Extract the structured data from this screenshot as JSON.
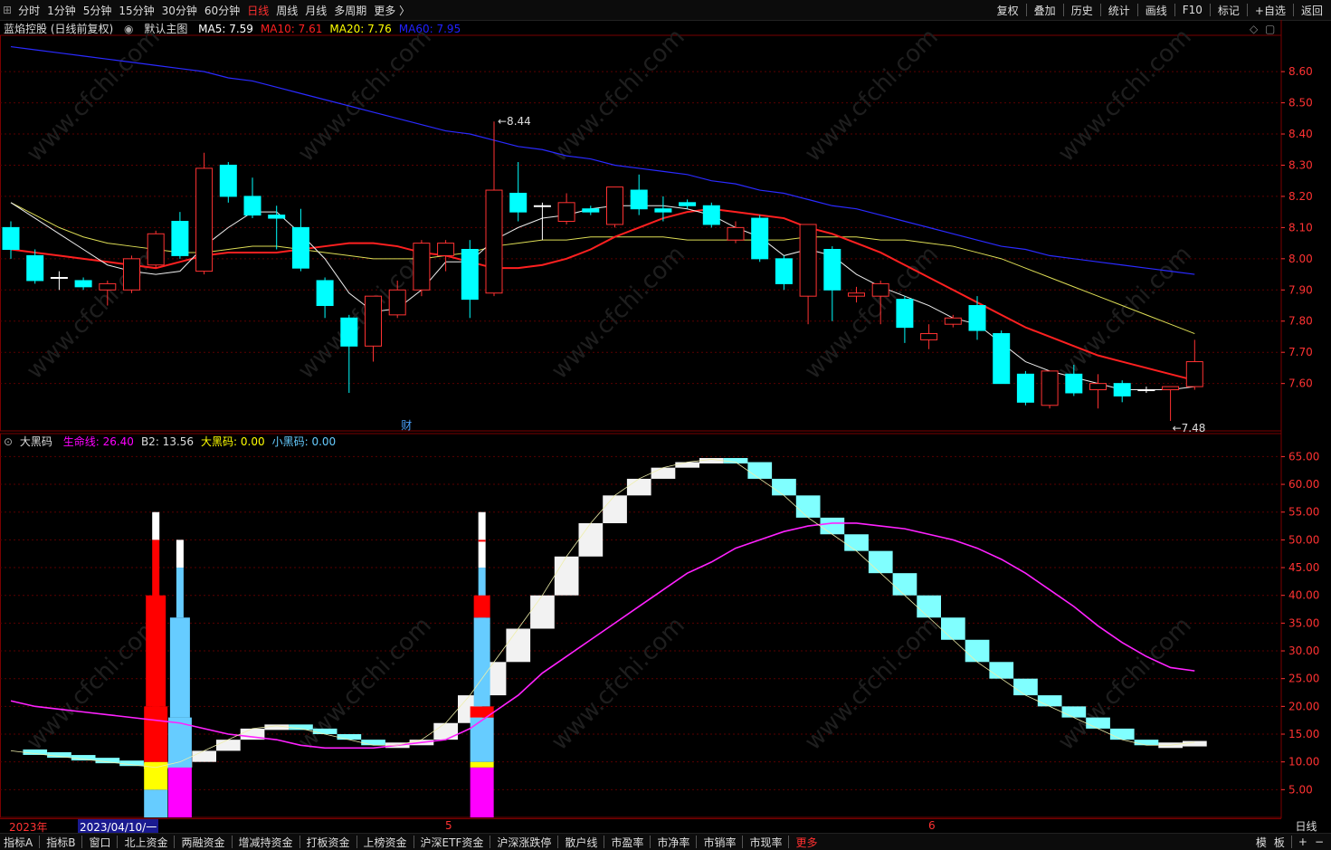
{
  "toolbar": {
    "periods": [
      "分时",
      "1分钟",
      "5分钟",
      "15分钟",
      "30分钟",
      "60分钟",
      "日线",
      "周线",
      "月线",
      "多周期",
      "更多 〉"
    ],
    "active_period": "日线",
    "actions": [
      "复权",
      "叠加",
      "历史",
      "统计",
      "画线",
      "F10",
      "标记",
      "+自选",
      "返回"
    ]
  },
  "main_chart": {
    "stock_name": "蓝焰控股 (日线前复权)",
    "indicator": "默认主图",
    "ma": [
      {
        "label": "MA5: 7.59",
        "color": "#ffffff"
      },
      {
        "label": "MA10: 7.61",
        "color": "#ff2020"
      },
      {
        "label": "MA20: 7.76",
        "color": "#ffff00"
      },
      {
        "label": "MA60: 7.95",
        "color": "#2020ff"
      }
    ],
    "high_label": "8.44",
    "low_label": "7.48",
    "event_marker": "财",
    "y_ticks": [
      "8.60",
      "8.50",
      "8.40",
      "8.30",
      "8.20",
      "8.10",
      "8.00",
      "7.90",
      "7.80",
      "7.70",
      "7.60"
    ]
  },
  "sub_chart": {
    "indicator": "大黑码",
    "legend": [
      {
        "label": "生命线: 26.40",
        "color": "#ff00ff"
      },
      {
        "label": "B2: 13.56",
        "color": "#dddddd"
      },
      {
        "label": "大黑码: 0.00",
        "color": "#ffff00"
      },
      {
        "label": "小黑码: 0.00",
        "color": "#66ccff"
      }
    ],
    "y_ticks": [
      "65.00",
      "60.00",
      "55.00",
      "50.00",
      "45.00",
      "40.00",
      "35.00",
      "30.00",
      "25.00",
      "20.00",
      "15.00",
      "10.00",
      "5.00"
    ]
  },
  "date_axis": {
    "year": "2023年",
    "cursor_date": "2023/04/10/一",
    "month_5": "5",
    "month_6": "6",
    "period_label": "日线"
  },
  "bottom_tabs": [
    "指标A",
    "指标B",
    "窗口",
    "北上资金",
    "两融资金",
    "增减持资金",
    "打板资金",
    "上榜资金",
    "沪深ETF资金",
    "沪深涨跌停",
    "散户线",
    "市盈率",
    "市净率",
    "市销率",
    "市现率",
    "更多"
  ],
  "bottom_right": [
    "模",
    "板",
    "+",
    "−"
  ],
  "watermark": "www.cfchi.com",
  "colors": {
    "up": "#ff3232",
    "down": "#00ffff",
    "grid": "#5a0000",
    "axis_text": "#ff3232"
  },
  "chart_data": [
    {
      "type": "candlestick",
      "title": "蓝焰控股 (日线前复权)",
      "ylim": [
        7.48,
        8.67
      ],
      "candles": [
        {
          "o": 8.1,
          "h": 8.12,
          "l": 8.0,
          "c": 8.03
        },
        {
          "o": 8.01,
          "h": 8.03,
          "l": 7.92,
          "c": 7.93
        },
        {
          "o": 7.94,
          "h": 7.96,
          "l": 7.9,
          "c": 7.94
        },
        {
          "o": 7.93,
          "h": 7.94,
          "l": 7.9,
          "c": 7.91
        },
        {
          "o": 7.9,
          "h": 7.93,
          "l": 7.85,
          "c": 7.92
        },
        {
          "o": 7.9,
          "h": 8.01,
          "l": 7.89,
          "c": 8.0
        },
        {
          "o": 7.98,
          "h": 8.09,
          "l": 7.97,
          "c": 8.08
        },
        {
          "o": 8.12,
          "h": 8.15,
          "l": 8.0,
          "c": 8.01
        },
        {
          "o": 7.96,
          "h": 8.34,
          "l": 7.95,
          "c": 8.29
        },
        {
          "o": 8.3,
          "h": 8.31,
          "l": 8.18,
          "c": 8.2
        },
        {
          "o": 8.2,
          "h": 8.26,
          "l": 8.13,
          "c": 8.14
        },
        {
          "o": 8.14,
          "h": 8.17,
          "l": 8.03,
          "c": 8.13
        },
        {
          "o": 8.1,
          "h": 8.16,
          "l": 7.96,
          "c": 7.97
        },
        {
          "o": 7.93,
          "h": 7.94,
          "l": 7.81,
          "c": 7.85
        },
        {
          "o": 7.81,
          "h": 7.82,
          "l": 7.57,
          "c": 7.72
        },
        {
          "o": 7.72,
          "h": 7.88,
          "l": 7.67,
          "c": 7.88
        },
        {
          "o": 7.82,
          "h": 7.93,
          "l": 7.81,
          "c": 7.9
        },
        {
          "o": 7.9,
          "h": 8.06,
          "l": 7.88,
          "c": 8.05
        },
        {
          "o": 8.01,
          "h": 8.06,
          "l": 7.96,
          "c": 8.05
        },
        {
          "o": 8.03,
          "h": 8.06,
          "l": 7.81,
          "c": 7.87
        },
        {
          "o": 7.89,
          "h": 8.44,
          "l": 7.88,
          "c": 8.22
        },
        {
          "o": 8.21,
          "h": 8.31,
          "l": 8.12,
          "c": 8.15
        },
        {
          "o": 8.17,
          "h": 8.18,
          "l": 8.06,
          "c": 8.17
        },
        {
          "o": 8.12,
          "h": 8.21,
          "l": 8.11,
          "c": 8.18
        },
        {
          "o": 8.16,
          "h": 8.17,
          "l": 8.14,
          "c": 8.15
        },
        {
          "o": 8.11,
          "h": 8.23,
          "l": 8.1,
          "c": 8.23
        },
        {
          "o": 8.22,
          "h": 8.27,
          "l": 8.14,
          "c": 8.16
        },
        {
          "o": 8.16,
          "h": 8.2,
          "l": 8.12,
          "c": 8.15
        },
        {
          "o": 8.18,
          "h": 8.19,
          "l": 8.16,
          "c": 8.17
        },
        {
          "o": 8.17,
          "h": 8.18,
          "l": 8.1,
          "c": 8.11
        },
        {
          "o": 8.06,
          "h": 8.12,
          "l": 8.05,
          "c": 8.1
        },
        {
          "o": 8.13,
          "h": 8.14,
          "l": 7.99,
          "c": 8.0
        },
        {
          "o": 8.0,
          "h": 8.01,
          "l": 7.9,
          "c": 7.92
        },
        {
          "o": 7.88,
          "h": 8.11,
          "l": 7.79,
          "c": 8.11
        },
        {
          "o": 8.03,
          "h": 8.04,
          "l": 7.8,
          "c": 7.9
        },
        {
          "o": 7.88,
          "h": 7.91,
          "l": 7.86,
          "c": 7.89
        },
        {
          "o": 7.88,
          "h": 7.93,
          "l": 7.79,
          "c": 7.92
        },
        {
          "o": 7.87,
          "h": 7.88,
          "l": 7.73,
          "c": 7.78
        },
        {
          "o": 7.74,
          "h": 7.79,
          "l": 7.71,
          "c": 7.76
        },
        {
          "o": 7.79,
          "h": 7.82,
          "l": 7.78,
          "c": 7.81
        },
        {
          "o": 7.85,
          "h": 7.88,
          "l": 7.74,
          "c": 7.77
        },
        {
          "o": 7.76,
          "h": 7.77,
          "l": 7.61,
          "c": 7.6
        },
        {
          "o": 7.63,
          "h": 7.64,
          "l": 7.53,
          "c": 7.54
        },
        {
          "o": 7.53,
          "h": 7.64,
          "l": 7.52,
          "c": 7.64
        },
        {
          "o": 7.63,
          "h": 7.66,
          "l": 7.56,
          "c": 7.57
        },
        {
          "o": 7.58,
          "h": 7.63,
          "l": 7.52,
          "c": 7.6
        },
        {
          "o": 7.6,
          "h": 7.61,
          "l": 7.54,
          "c": 7.56
        },
        {
          "o": 7.58,
          "h": 7.59,
          "l": 7.57,
          "c": 7.58
        },
        {
          "o": 7.58,
          "h": 7.59,
          "l": 7.48,
          "c": 7.59
        },
        {
          "o": 7.59,
          "h": 7.74,
          "l": 7.58,
          "c": 7.67
        }
      ],
      "ma5": [
        8.18,
        8.13,
        8.08,
        8.03,
        7.98,
        7.96,
        7.95,
        7.96,
        8.04,
        8.1,
        8.15,
        8.15,
        8.08,
        8.0,
        7.89,
        7.83,
        7.84,
        7.9,
        7.99,
        7.99,
        8.06,
        8.1,
        8.13,
        8.14,
        8.16,
        8.17,
        8.17,
        8.17,
        8.16,
        8.14,
        8.1,
        8.07,
        8.01,
        8.03,
        8.01,
        7.95,
        7.91,
        7.88,
        7.85,
        7.81,
        7.79,
        7.73,
        7.67,
        7.64,
        7.62,
        7.6,
        7.58,
        7.58,
        7.58,
        7.59
      ],
      "ma10": [
        8.03,
        8.02,
        8.01,
        8.0,
        7.99,
        7.98,
        7.97,
        7.99,
        8.01,
        8.02,
        8.02,
        8.02,
        8.03,
        8.04,
        8.05,
        8.05,
        8.04,
        8.02,
        8.01,
        7.99,
        7.97,
        7.97,
        7.98,
        8.0,
        8.03,
        8.07,
        8.1,
        8.13,
        8.15,
        8.16,
        8.15,
        8.14,
        8.13,
        8.1,
        8.08,
        8.05,
        8.02,
        7.98,
        7.94,
        7.9,
        7.86,
        7.82,
        7.78,
        7.75,
        7.72,
        7.69,
        7.67,
        7.65,
        7.63,
        7.61
      ],
      "ma20": [
        8.18,
        8.14,
        8.1,
        8.07,
        8.05,
        8.04,
        8.03,
        8.02,
        8.02,
        8.03,
        8.04,
        8.04,
        8.03,
        8.02,
        8.01,
        8.0,
        8.0,
        8.0,
        8.01,
        8.02,
        8.04,
        8.05,
        8.06,
        8.06,
        8.07,
        8.07,
        8.07,
        8.07,
        8.06,
        8.06,
        8.06,
        8.06,
        8.06,
        8.07,
        8.07,
        8.07,
        8.06,
        8.06,
        8.05,
        8.04,
        8.02,
        8.0,
        7.97,
        7.94,
        7.91,
        7.88,
        7.85,
        7.82,
        7.79,
        7.76
      ],
      "ma60": [
        8.68,
        8.67,
        8.66,
        8.65,
        8.64,
        8.63,
        8.62,
        8.61,
        8.6,
        8.58,
        8.57,
        8.55,
        8.53,
        8.51,
        8.49,
        8.47,
        8.45,
        8.43,
        8.41,
        8.4,
        8.38,
        8.36,
        8.35,
        8.33,
        8.32,
        8.3,
        8.29,
        8.28,
        8.27,
        8.25,
        8.24,
        8.22,
        8.21,
        8.19,
        8.17,
        8.16,
        8.14,
        8.12,
        8.1,
        8.08,
        8.06,
        8.04,
        8.03,
        8.01,
        8.0,
        7.99,
        7.98,
        7.97,
        7.96,
        7.95
      ]
    },
    {
      "type": "bar",
      "title": "大黑码",
      "ylim": [
        0,
        68
      ],
      "series": [
        {
          "name": "生命线",
          "values": [
            21,
            20,
            19.5,
            19,
            18.5,
            18,
            17.5,
            17,
            16,
            15,
            14.5,
            14,
            13,
            12.5,
            12.5,
            12.5,
            13,
            13.5,
            14,
            16,
            19,
            22,
            26,
            29,
            32,
            35,
            38,
            41,
            44,
            46,
            48.5,
            50,
            51.5,
            52.5,
            53,
            53,
            52.5,
            52,
            51,
            50,
            48.5,
            46.5,
            44,
            41,
            38,
            34.5,
            31.5,
            29,
            27,
            26.4
          ]
        },
        {
          "name": "B2",
          "values": [
            12,
            11.5,
            11,
            10.5,
            10,
            9.5,
            9,
            10,
            12,
            14,
            16,
            16.5,
            16,
            15,
            14,
            13,
            13,
            14,
            17,
            22,
            28,
            34,
            40,
            47,
            53,
            58,
            61,
            63,
            64,
            64.5,
            64,
            61,
            58,
            54,
            51,
            48,
            44,
            40,
            36,
            32,
            28,
            25,
            22,
            20,
            18,
            16,
            14,
            13,
            13,
            13.56
          ]
        },
        {
          "name": "大黑码",
          "values": [
            0,
            0,
            0,
            0,
            0,
            0,
            10,
            10,
            0,
            0,
            0,
            0,
            0,
            0,
            0,
            0,
            0,
            0,
            0,
            10,
            10,
            0,
            0,
            0,
            0,
            0,
            0,
            0,
            0,
            0,
            0,
            0,
            0,
            0,
            0,
            0,
            0,
            0,
            0,
            0,
            0,
            0,
            0,
            0,
            0,
            0,
            0,
            0,
            0,
            0
          ]
        },
        {
          "name": "小黑码",
          "values": [
            0,
            0,
            0,
            0,
            0,
            0,
            5,
            9,
            0,
            0,
            0,
            0,
            0,
            0,
            0,
            0,
            0,
            0,
            0,
            9,
            0,
            0,
            0,
            0,
            0,
            0,
            0,
            0,
            0,
            0,
            0,
            0,
            0,
            0,
            0,
            0,
            0,
            0,
            0,
            0,
            0,
            0,
            0,
            0,
            0,
            0,
            0,
            0,
            0,
            0
          ]
        }
      ]
    }
  ]
}
